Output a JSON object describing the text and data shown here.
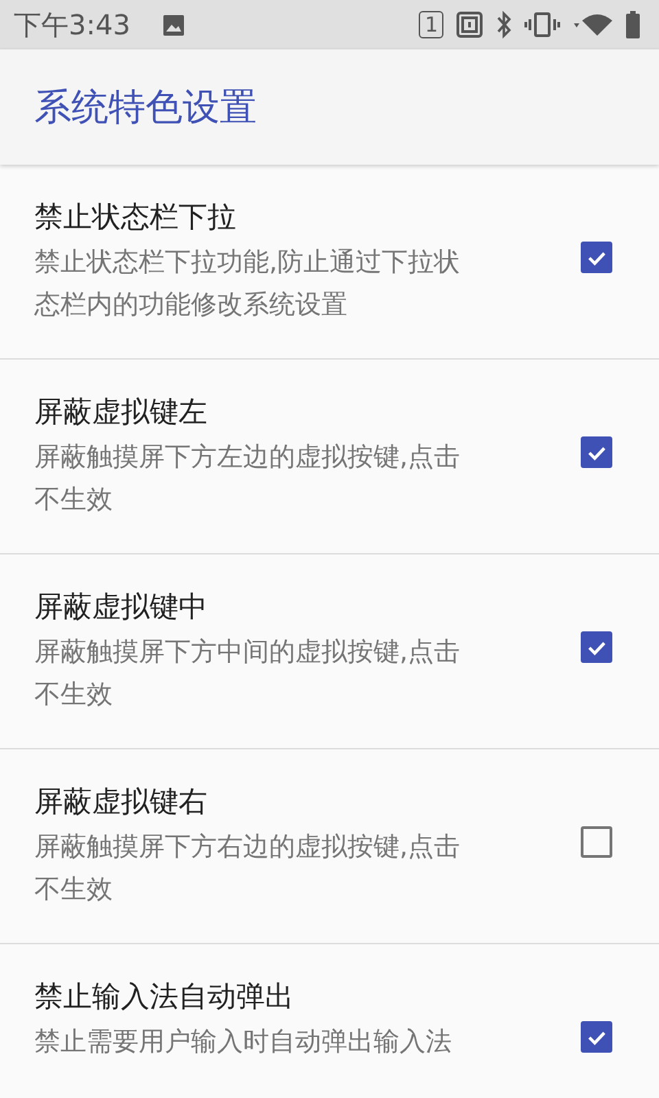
{
  "status_bar": {
    "time": "下午3:43",
    "sim_slot": "1"
  },
  "toolbar": {
    "title": "系统特色设置"
  },
  "settings": [
    {
      "title": "禁止状态栏下拉",
      "summary": "禁止状态栏下拉功能,防止通过下拉状态栏内的功能修改系统设置",
      "checked": true
    },
    {
      "title": "屏蔽虚拟键左",
      "summary": "屏蔽触摸屏下方左边的虚拟按键,点击不生效",
      "checked": true
    },
    {
      "title": "屏蔽虚拟键中",
      "summary": "屏蔽触摸屏下方中间的虚拟按键,点击不生效",
      "checked": true
    },
    {
      "title": "屏蔽虚拟键右",
      "summary": "屏蔽触摸屏下方右边的虚拟按键,点击不生效",
      "checked": false
    },
    {
      "title": "禁止输入法自动弹出",
      "summary": "禁止需要用户输入时自动弹出输入法",
      "checked": true
    }
  ]
}
